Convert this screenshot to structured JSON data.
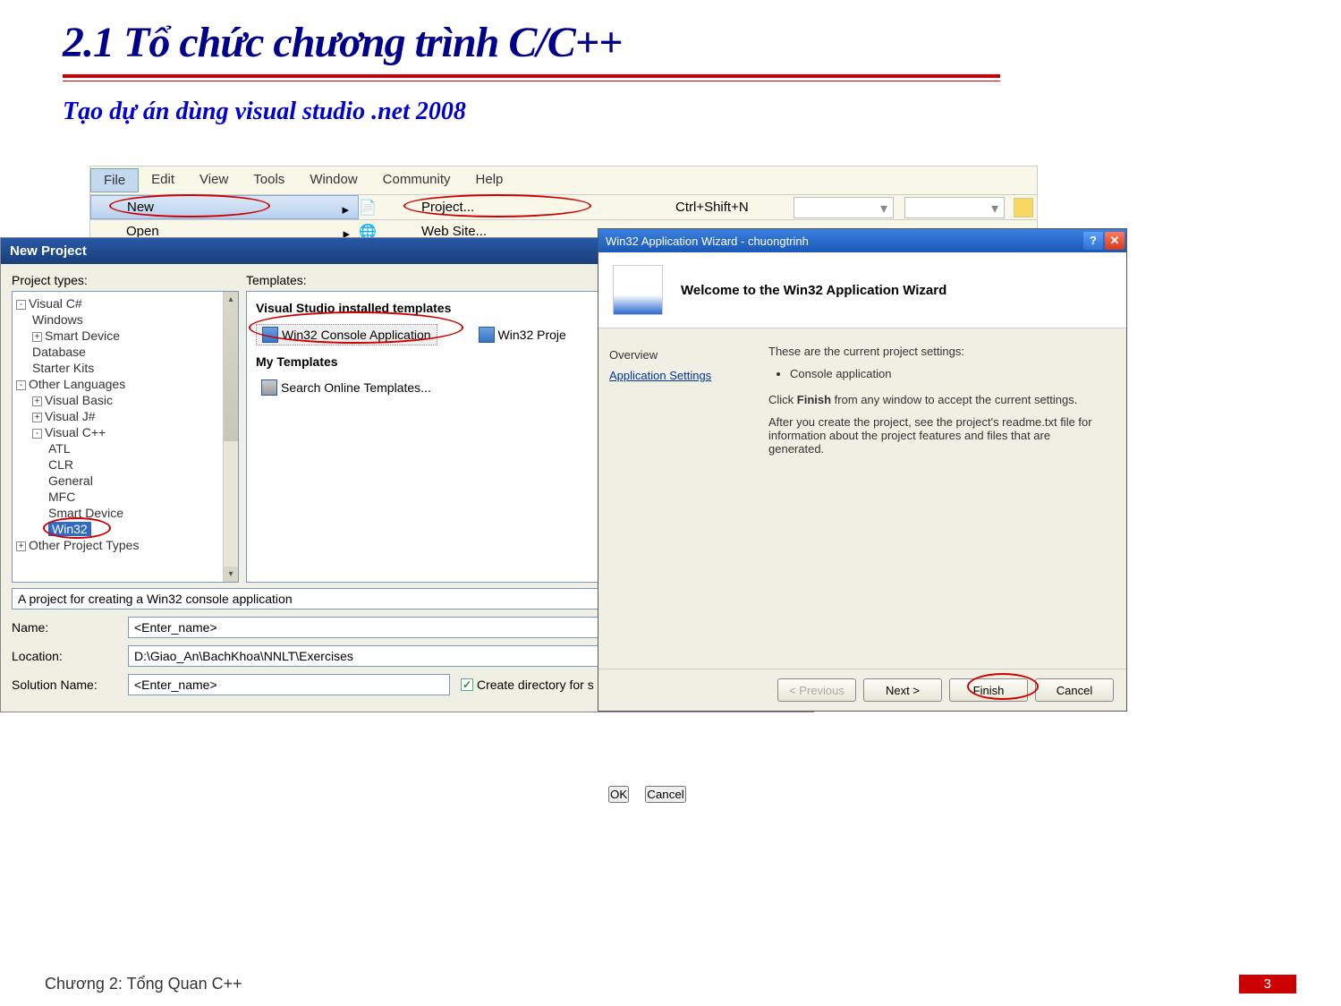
{
  "title": "2.1 Tổ chức chương trình C/C++",
  "subtitle": "Tạo dự án dùng visual studio .net 2008",
  "menubar": {
    "items": [
      "File",
      "Edit",
      "View",
      "Tools",
      "Window",
      "Community",
      "Help"
    ],
    "file_submenu": {
      "new": "New",
      "open": "Open"
    },
    "new_submenu": {
      "project": "Project...",
      "shortcut": "Ctrl+Shift+N",
      "website": "Web Site..."
    }
  },
  "new_project": {
    "title": "New Project",
    "project_types_label": "Project types:",
    "templates_label": "Templates:",
    "tree": {
      "vcs": "Visual C#",
      "windows": "Windows",
      "smart_device": "Smart Device",
      "database": "Database",
      "starter_kits": "Starter Kits",
      "other_lang": "Other Languages",
      "vb": "Visual Basic",
      "vj": "Visual J#",
      "vcpp": "Visual C++",
      "atl": "ATL",
      "clr": "CLR",
      "general": "General",
      "mfc": "MFC",
      "smart_device2": "Smart Device",
      "win32": "Win32",
      "other_proj": "Other Project Types"
    },
    "templates": {
      "installed_section": "Visual Studio installed templates",
      "win32_console": "Win32 Console Application",
      "win32_proj": "Win32 Proje",
      "my_templates_section": "My Templates",
      "search_online": "Search Online Templates..."
    },
    "description": "A project for creating a Win32 console application",
    "name_label": "Name:",
    "name_value": "<Enter_name>",
    "location_label": "Location:",
    "location_value": "D:\\Giao_An\\BachKhoa\\NNLT\\Exercises",
    "solution_label": "Solution Name:",
    "solution_value": "<Enter_name>",
    "create_dir_label": "Create directory for s",
    "ok_label": "OK",
    "cancel_label": "Cancel"
  },
  "wizard": {
    "title": "Win32 Application Wizard - chuongtrinh",
    "welcome": "Welcome to the Win32 Application Wizard",
    "nav": {
      "overview": "Overview",
      "settings": "Application Settings"
    },
    "body": {
      "line1": "These are the current project settings:",
      "bullet": "Console application",
      "line2_a": "Click ",
      "line2_b": "Finish",
      "line2_c": " from any window to accept the current settings.",
      "line3": "After you create the project, see the project's readme.txt file for information about the project features and files that are generated."
    },
    "buttons": {
      "prev": "< Previous",
      "next": "Next >",
      "finish": "Finish",
      "cancel": "Cancel"
    }
  },
  "footer": {
    "chapter": "Chương 2: Tổng Quan C++",
    "page": "3"
  }
}
